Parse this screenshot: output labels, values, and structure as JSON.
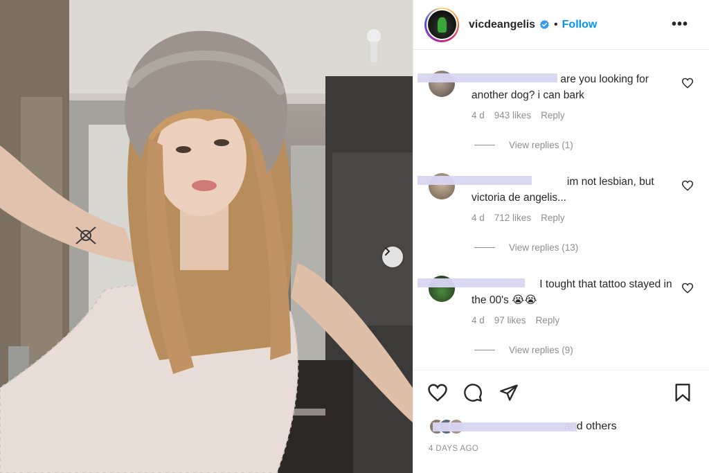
{
  "post": {
    "username": "vicdeangelis",
    "separator": "•",
    "follow_label": "Follow",
    "more_label": "•••",
    "date": "4 DAYS AGO",
    "likes_suffix": "and others"
  },
  "comments": [
    {
      "text": "are you looking for another dog? i can bark",
      "age": "4 d",
      "likes": "943 likes",
      "reply_label": "Reply",
      "view_replies": "View replies (1)"
    },
    {
      "text": "im not lesbian, but victoria de angelis...",
      "age": "4 d",
      "likes": "712 likes",
      "reply_label": "Reply",
      "view_replies": "View replies (13)"
    },
    {
      "text": "I tought that tattoo stayed in the 00's 😭😭",
      "age": "4 d",
      "likes": "97 likes",
      "reply_label": "Reply",
      "view_replies": "View replies (9)"
    }
  ],
  "icons": {
    "verified": "verified-badge-icon",
    "heart": "heart-icon",
    "comment": "comment-icon",
    "share": "share-icon",
    "save": "bookmark-icon",
    "next": "chevron-right-icon"
  },
  "colors": {
    "accent": "#0095f6",
    "text": "#262626",
    "muted": "#8e8e8e",
    "redaction": "#d9d6f3"
  }
}
